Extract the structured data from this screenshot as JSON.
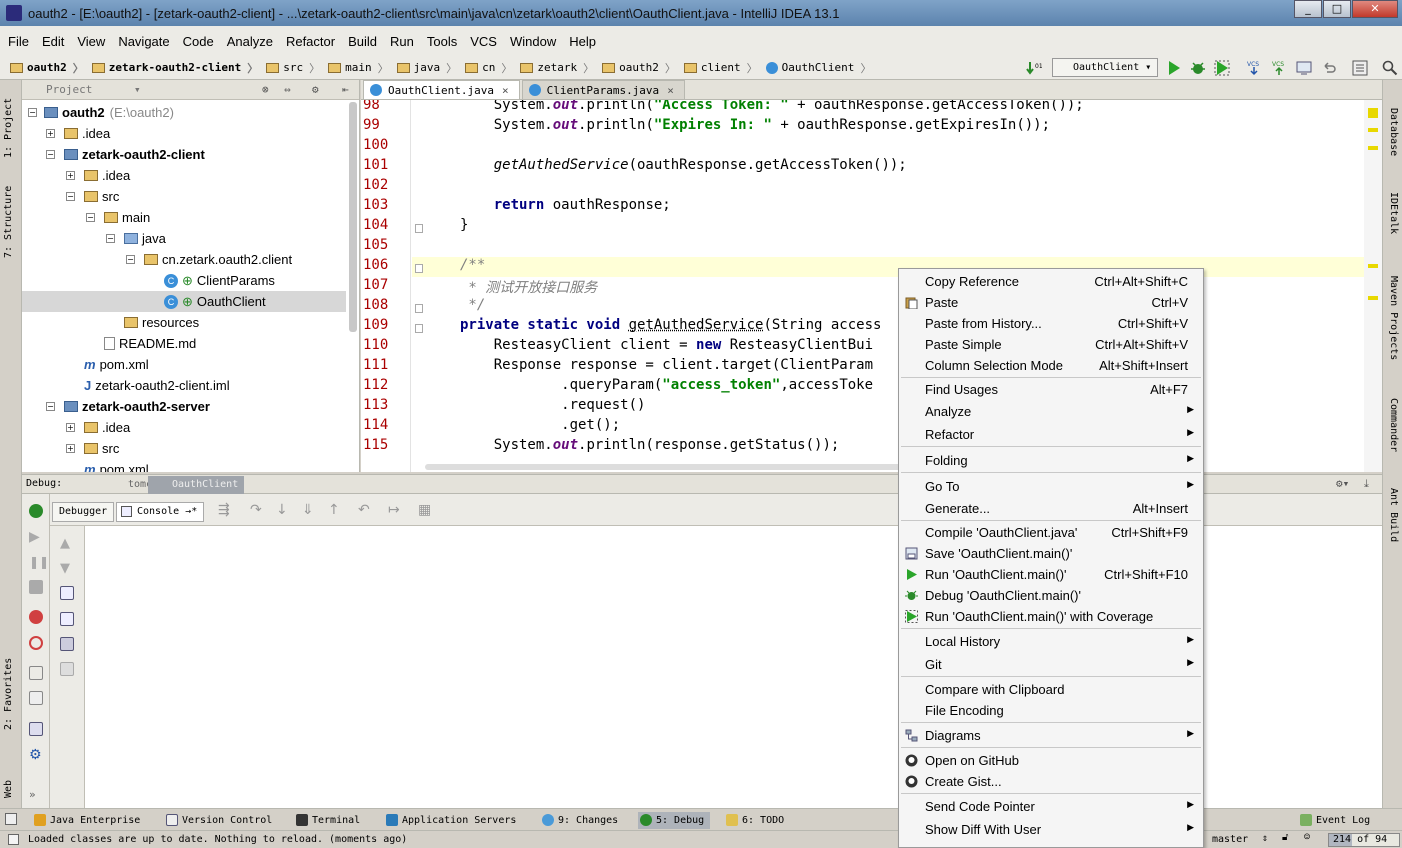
{
  "window": {
    "title": "oauth2 - [E:\\oauth2] - [zetark-oauth2-client] - ...\\zetark-oauth2-client\\src\\main\\java\\cn\\zetark\\oauth2\\client\\OauthClient.java - IntelliJ IDEA 13.1"
  },
  "menu": [
    "File",
    "Edit",
    "View",
    "Navigate",
    "Code",
    "Analyze",
    "Refactor",
    "Build",
    "Run",
    "Tools",
    "VCS",
    "Window",
    "Help"
  ],
  "breadcrumbs": [
    "oauth2",
    "zetark-oauth2-client",
    "src",
    "main",
    "java",
    "cn",
    "zetark",
    "oauth2",
    "client",
    "OauthClient"
  ],
  "run_config": "OauthClient",
  "left_tabs": [
    "1: Project",
    "7: Structure",
    "2: Favorites",
    "Web"
  ],
  "right_tabs": [
    "Database",
    "IDEtalk",
    "Maven Projects",
    "Commander",
    "Ant Build"
  ],
  "project": {
    "header": "Project",
    "tree": [
      {
        "label": "oauth2",
        "note": "(E:\\oauth2)",
        "bold": true
      },
      {
        "label": ".idea"
      },
      {
        "label": "zetark-oauth2-client",
        "bold": true
      },
      {
        "label": ".idea"
      },
      {
        "label": "src"
      },
      {
        "label": "main"
      },
      {
        "label": "java"
      },
      {
        "label": "cn.zetark.oauth2.client"
      },
      {
        "label": "ClientParams"
      },
      {
        "label": "OauthClient"
      },
      {
        "label": "resources"
      },
      {
        "label": "README.md"
      },
      {
        "label": "pom.xml"
      },
      {
        "label": "zetark-oauth2-client.iml"
      },
      {
        "label": "zetark-oauth2-server",
        "bold": true
      },
      {
        "label": ".idea"
      },
      {
        "label": "src"
      },
      {
        "label": "pom.xml"
      }
    ]
  },
  "editor": {
    "tabs": [
      "OauthClient.java",
      "ClientParams.java"
    ],
    "line_numbers": [
      "98",
      "99",
      "100",
      "101",
      "102",
      "103",
      "104",
      "105",
      "106",
      "107",
      "108",
      "109",
      "110",
      "111",
      "112",
      "113",
      "114",
      "115"
    ]
  },
  "debug": {
    "label": "Debug:",
    "sessions": [
      "tomcat",
      "OauthClient"
    ],
    "tabs": [
      "Debugger",
      "Console"
    ]
  },
  "context_menu": [
    {
      "label": "Copy Reference",
      "shortcut": "Ctrl+Alt+Shift+C"
    },
    {
      "label": "Paste",
      "shortcut": "Ctrl+V"
    },
    {
      "label": "Paste from History...",
      "shortcut": "Ctrl+Shift+V"
    },
    {
      "label": "Paste Simple",
      "shortcut": "Ctrl+Alt+Shift+V"
    },
    {
      "label": "Column Selection Mode",
      "shortcut": "Alt+Shift+Insert"
    },
    {
      "label": "Find Usages",
      "shortcut": "Alt+F7"
    },
    {
      "label": "Analyze",
      "shortcut": ""
    },
    {
      "label": "Refactor",
      "shortcut": ""
    },
    {
      "label": "Folding",
      "shortcut": ""
    },
    {
      "label": "Go To",
      "shortcut": ""
    },
    {
      "label": "Generate...",
      "shortcut": "Alt+Insert"
    },
    {
      "label": "Compile 'OauthClient.java'",
      "shortcut": "Ctrl+Shift+F9"
    },
    {
      "label": "Save 'OauthClient.main()'",
      "shortcut": ""
    },
    {
      "label": "Run 'OauthClient.main()'",
      "shortcut": "Ctrl+Shift+F10"
    },
    {
      "label": "Debug 'OauthClient.main()'",
      "shortcut": ""
    },
    {
      "label": "Run 'OauthClient.main()' with Coverage",
      "shortcut": ""
    },
    {
      "label": "Local History",
      "shortcut": ""
    },
    {
      "label": "Git",
      "shortcut": ""
    },
    {
      "label": "Compare with Clipboard",
      "shortcut": ""
    },
    {
      "label": "File Encoding",
      "shortcut": ""
    },
    {
      "label": "Diagrams",
      "shortcut": ""
    },
    {
      "label": "Open on GitHub",
      "shortcut": ""
    },
    {
      "label": "Create Gist...",
      "shortcut": ""
    },
    {
      "label": "Send Code Pointer",
      "shortcut": ""
    },
    {
      "label": "Show Diff With User",
      "shortcut": ""
    }
  ],
  "bottom_tools": [
    "Java Enterprise",
    "Version Control",
    "Terminal",
    "Application Servers",
    "9: Changes",
    "5: Debug",
    "6: TODO",
    "Event Log"
  ],
  "status": {
    "message": "Loaded classes are up to date. Nothing to reload. (moments ago)",
    "branch": "master",
    "memory": "214 of 94"
  },
  "colors": {
    "keyword": "#000080",
    "string": "#008000",
    "field": "#660e7a",
    "comment": "#808080",
    "line_number": "#aa0000",
    "highlight_line": "#ffffd7"
  }
}
